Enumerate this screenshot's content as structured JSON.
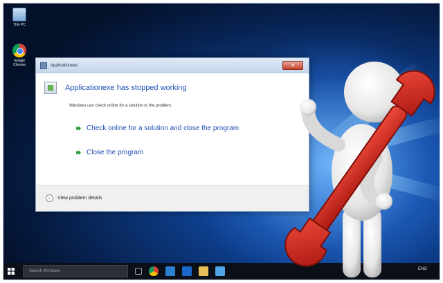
{
  "desktop": {
    "icons": [
      {
        "name": "this-pc",
        "label": "This PC"
      },
      {
        "name": "google-chrome",
        "label": "Google Chrome"
      }
    ]
  },
  "dialog": {
    "title": "Applicationexe",
    "close_glyph": "✕",
    "headline": "Applicationexe has stopped working",
    "subtext": "Windows can check online for a solution to the problem.",
    "options": [
      "Check online for a solution and close the program",
      "Close the program"
    ],
    "footer_label": "View problem details",
    "footer_chevron": "⌄"
  },
  "taskbar": {
    "search_placeholder": "Search Windows",
    "pinned": [
      "task-view",
      "chrome",
      "store",
      "edge",
      "explorer",
      "mail"
    ],
    "tray_text": "ENG"
  },
  "colors": {
    "desktop_bg": "#0d3d8a",
    "link_blue": "#1e4fb5",
    "wrench_red": "#c8221b"
  }
}
